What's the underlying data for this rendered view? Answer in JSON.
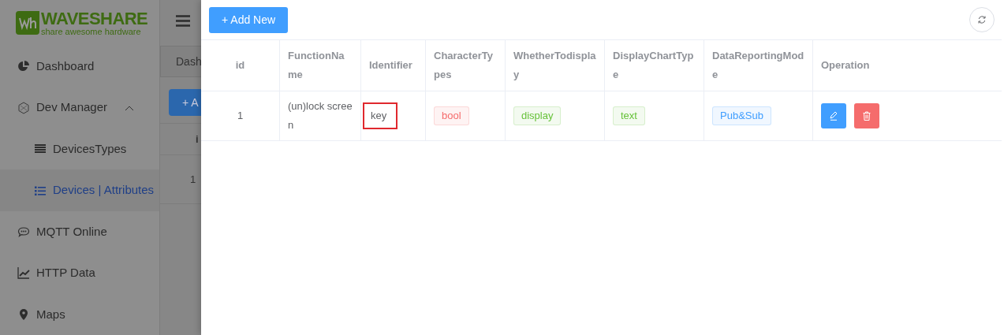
{
  "logo": {
    "name": "WAVESHARE",
    "tagline": "share awesome hardware"
  },
  "sidebar": {
    "items": [
      {
        "label": "Dashboard",
        "selected": false
      },
      {
        "label": "Dev Manager",
        "selected": false,
        "expanded": true,
        "children": [
          {
            "label": "DevicesTypes",
            "selected": false
          },
          {
            "label": "Devices | Attributes",
            "selected": true
          }
        ]
      },
      {
        "label": "MQTT Online",
        "selected": false
      },
      {
        "label": "HTTP Data",
        "selected": false
      },
      {
        "label": "Maps",
        "selected": false
      }
    ]
  },
  "background_page": {
    "tab": "Dash",
    "button": "+ A",
    "column_1": "i",
    "row_1": "1"
  },
  "drawer": {
    "add_button": "+ Add New",
    "table": {
      "columns": [
        "id",
        "FunctionName",
        "Identifier",
        "CharacterTypes",
        "WhetherTodisplay",
        "DisplayChartType",
        "DataReportingMode",
        "Operation"
      ],
      "rows": [
        {
          "id": "1",
          "function_name": "(un)lock screen",
          "identifier": "key",
          "identifier_highlighted": true,
          "tags": [
            {
              "text": "bool",
              "color": "#f56c6c"
            },
            {
              "text": "display",
              "color": "#67c23a"
            },
            {
              "text": "text",
              "color": "#67c23a"
            },
            {
              "text": "Pub&Sub",
              "color": "#409eff"
            }
          ]
        }
      ]
    }
  }
}
